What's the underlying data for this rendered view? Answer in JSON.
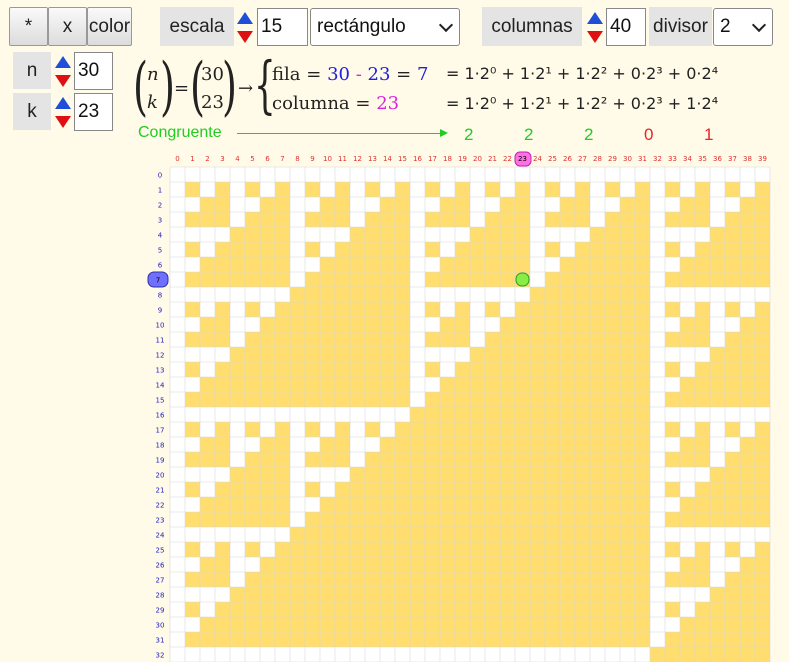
{
  "toolbar": {
    "star_label": "*",
    "x_label": "x",
    "color_label": "color",
    "scale_label": "escala",
    "scale_value": "15",
    "shape_value": "rectángulo",
    "columns_label": "columnas",
    "columns_value": "40",
    "divisor_label": "divisor",
    "divisor_value": "2"
  },
  "params": {
    "n_label": "n",
    "n_value": "30",
    "k_label": "k",
    "k_value": "23"
  },
  "formula": {
    "n_sym": "n",
    "k_sym": "k",
    "n_val": "30",
    "k_val": "23",
    "equals": "=",
    "arrow": "→",
    "fila_label": "fila",
    "eq": "=",
    "fila_a": "30",
    "minus": "-",
    "fila_b": "23",
    "fila_res": "7",
    "col_label": "columna",
    "col_res": "23",
    "row1_expansion": "= 1·2⁰ + 1·2¹ + 1·2² + 0·2³ + 0·2⁴",
    "row2_expansion": "= 1·2⁰ + 1·2¹ + 1·2² + 0·2³ + 1·2⁴",
    "congruent_label": "Congruente",
    "congruent_arrow": "⟶",
    "digits": [
      "2",
      "2",
      "2",
      "0",
      "1"
    ]
  },
  "grid": {
    "cols": 40,
    "rows": 33,
    "modulus": 2,
    "highlight_col": 23,
    "highlight_row": 7,
    "fill_color": "#ffdd6e",
    "empty_color": "#ffffff",
    "line_color": "#d8d8d8"
  }
}
